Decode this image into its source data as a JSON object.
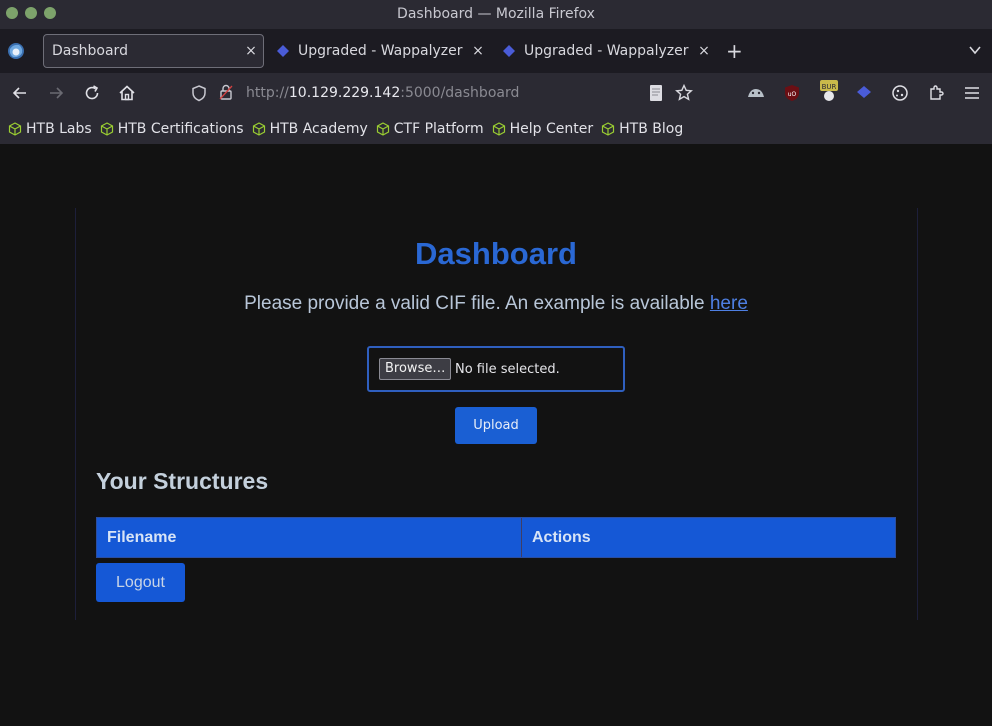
{
  "window": {
    "title": "Dashboard — Mozilla Firefox"
  },
  "tabs": [
    {
      "label": "Dashboard",
      "active": true
    },
    {
      "label": "Upgraded - Wappalyzer",
      "active": false
    },
    {
      "label": "Upgraded - Wappalyzer",
      "active": false
    }
  ],
  "tab_close_glyph": "×",
  "new_tab_glyph": "+",
  "urlbar": {
    "scheme": "http://",
    "host": "10.129.229.142",
    "rest": ":5000/dashboard"
  },
  "bookmarks": [
    "HTB Labs",
    "HTB Certifications",
    "HTB Academy",
    "CTF Platform",
    "Help Center",
    "HTB Blog"
  ],
  "page": {
    "heading": "Dashboard",
    "description": "Please provide a valid CIF file. An example is available ",
    "description_link": "here",
    "file_input": {
      "button_label": "Browse…",
      "status": "No file selected."
    },
    "upload_label": "Upload",
    "structures_heading": "Your Structures",
    "table_headers": [
      "Filename",
      "Actions"
    ],
    "logout_label": "Logout"
  },
  "colors": {
    "accent": "#1558d6",
    "heading": "#2a68d4",
    "page_bg": "#121212"
  }
}
